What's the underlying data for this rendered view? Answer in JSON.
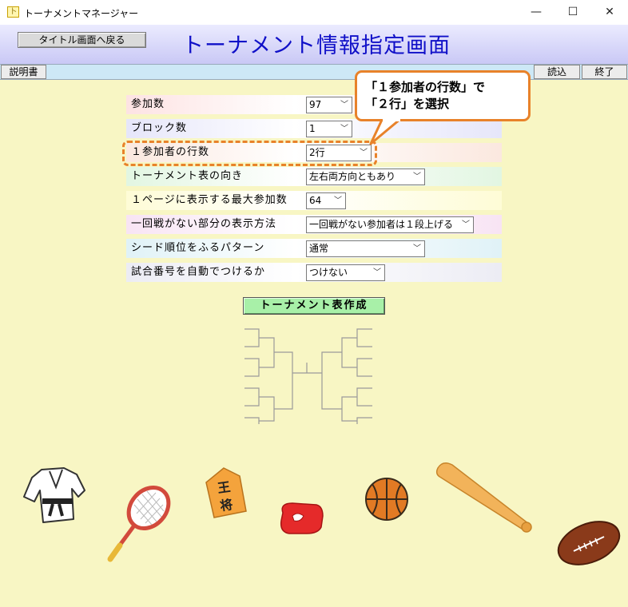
{
  "window": {
    "title": "トーナメントマネージャー",
    "controls": {
      "minimize": "—",
      "maximize": "☐",
      "close": "✕"
    }
  },
  "header": {
    "back_button": "タイトル画面へ戻る",
    "page_title": "トーナメント情報指定画面"
  },
  "menubar": {
    "manual": "説明書",
    "load": "読込",
    "exit": "終了"
  },
  "form": {
    "rows": [
      {
        "label": "参加数",
        "value": "97",
        "color": "#fde3e3"
      },
      {
        "label": "ブロック数",
        "value": "1",
        "color": "#e6e6fa"
      },
      {
        "label": "１参加者の行数",
        "value": "2行",
        "color": "#fbe8df"
      },
      {
        "label": "トーナメント表の向き",
        "value": "左右両方向ともあり",
        "color": "#e2f6e2"
      },
      {
        "label": "１ページに表示する最大参加数",
        "value": "64",
        "color": "#fefcd6"
      },
      {
        "label": "一回戦がない部分の表示方法",
        "value": "一回戦がない参加者は１段上げる",
        "color": "#f8e4f4"
      },
      {
        "label": "シード順位をふるパターン",
        "value": "通常",
        "color": "#e0f2f7"
      },
      {
        "label": "試合番号を自動でつけるか",
        "value": "つけない",
        "color": "#ececf4"
      }
    ]
  },
  "callout": {
    "line1": "「１参加者の行数」で",
    "line2": "「２行」を選択",
    "accent": "#e8822a"
  },
  "create_button": "トーナメント表作成",
  "decorations": {
    "shogi_piece_text": "王将"
  }
}
